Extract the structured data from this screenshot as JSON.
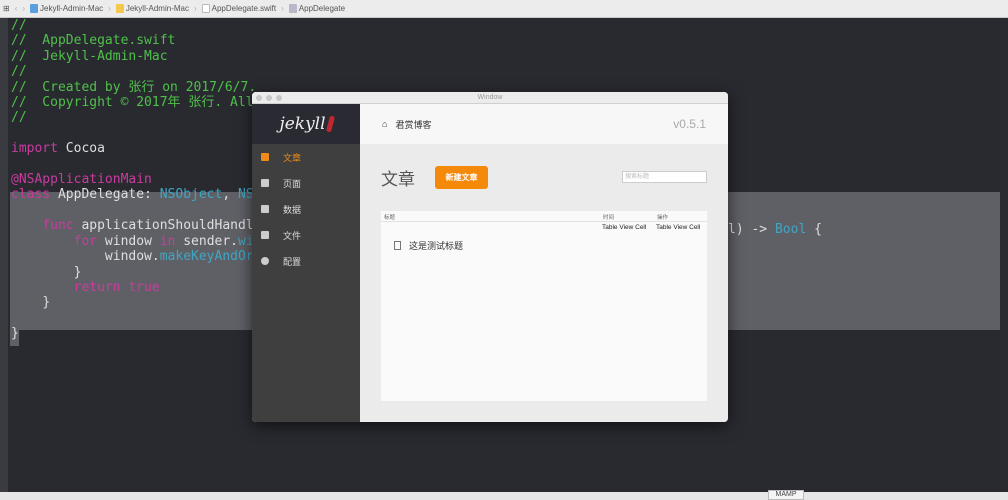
{
  "breadcrumb": [
    "Jekyll-Admin-Mac",
    "Jekyll-Admin-Mac",
    "AppDelegate.swift",
    "AppDelegate"
  ],
  "code": {
    "l1": "//",
    "l2": "//  AppDelegate.swift",
    "l3": "//  Jekyll-Admin-Mac",
    "l4": "//",
    "l5": "//  Created by 张行 on 2017/6/7.",
    "l6": "//  Copyright © 2017年 张行. All",
    "l7": "//",
    "import_kw": "import",
    "import_mod": " Cocoa",
    "attr": "@NSApplicationMain",
    "class_kw": "class",
    "class_name": " AppDelegate: ",
    "super1": "NSObject",
    "comma": ", ",
    "super2": "NS",
    "func_kw": "func",
    "func_name": " applicationShouldHandl",
    "for_kw": "for",
    "for_var": " window ",
    "in_kw": "in",
    "for_rest": " sender.",
    "for_tail": "wi",
    "win_obj": "window.",
    "win_method": "makeKeyAndOr",
    "close1": "}",
    "return_kw": "return true",
    "close2": "}",
    "close3": "}",
    "sig_tail_a": "l) -> ",
    "sig_type": "Bool",
    "sig_tail_b": " {"
  },
  "window": {
    "title": "Window",
    "logo": "jekyll",
    "site": "君赏博客",
    "version": "v0.5.1",
    "nav": [
      "文章",
      "页面",
      "数据",
      "文件",
      "配置"
    ],
    "page_title": "文章",
    "new_button": "新建文章",
    "search_placeholder": "搜索标题",
    "columns": [
      "标题",
      "时间",
      "操作"
    ],
    "row": {
      "title": "这是测试标题",
      "time": "Table View Cell",
      "action": "Table View Cell"
    }
  },
  "dock_label": "MAMP"
}
